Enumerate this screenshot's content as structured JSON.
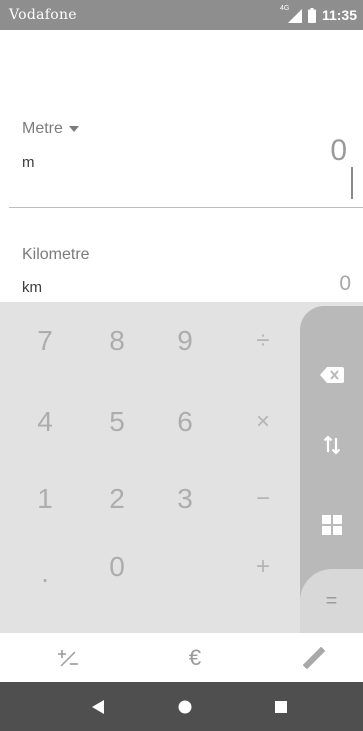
{
  "status_bar": {
    "carrier": "Vodafone",
    "network": "4G",
    "time": "11:35"
  },
  "from_unit": {
    "name": "Metre",
    "abbr": "m",
    "value": "0"
  },
  "to_unit": {
    "name": "Kilometre",
    "abbr": "km",
    "value": "0"
  },
  "keypad": {
    "k7": "7",
    "k8": "8",
    "k9": "9",
    "k4": "4",
    "k5": "5",
    "k6": "6",
    "k1": "1",
    "k2": "2",
    "k3": "3",
    "kdot": ".",
    "k0": "0",
    "divide": "÷",
    "multiply": "×",
    "minus": "−",
    "plus": "+",
    "equals": "="
  },
  "side_buttons": [
    "backspace-icon",
    "swap-units-icon",
    "grid-icon"
  ],
  "tools": [
    "plus-minus-icon",
    "euro-icon",
    "ruler-icon"
  ],
  "nav_buttons": [
    "back-icon",
    "home-icon",
    "recents-icon"
  ],
  "colors": {
    "status_bar": "#8e8e8e",
    "keypad_bg": "#e2e2e2",
    "side_panel": "#b9b9b9",
    "nav_bar": "#4f4f4f"
  }
}
